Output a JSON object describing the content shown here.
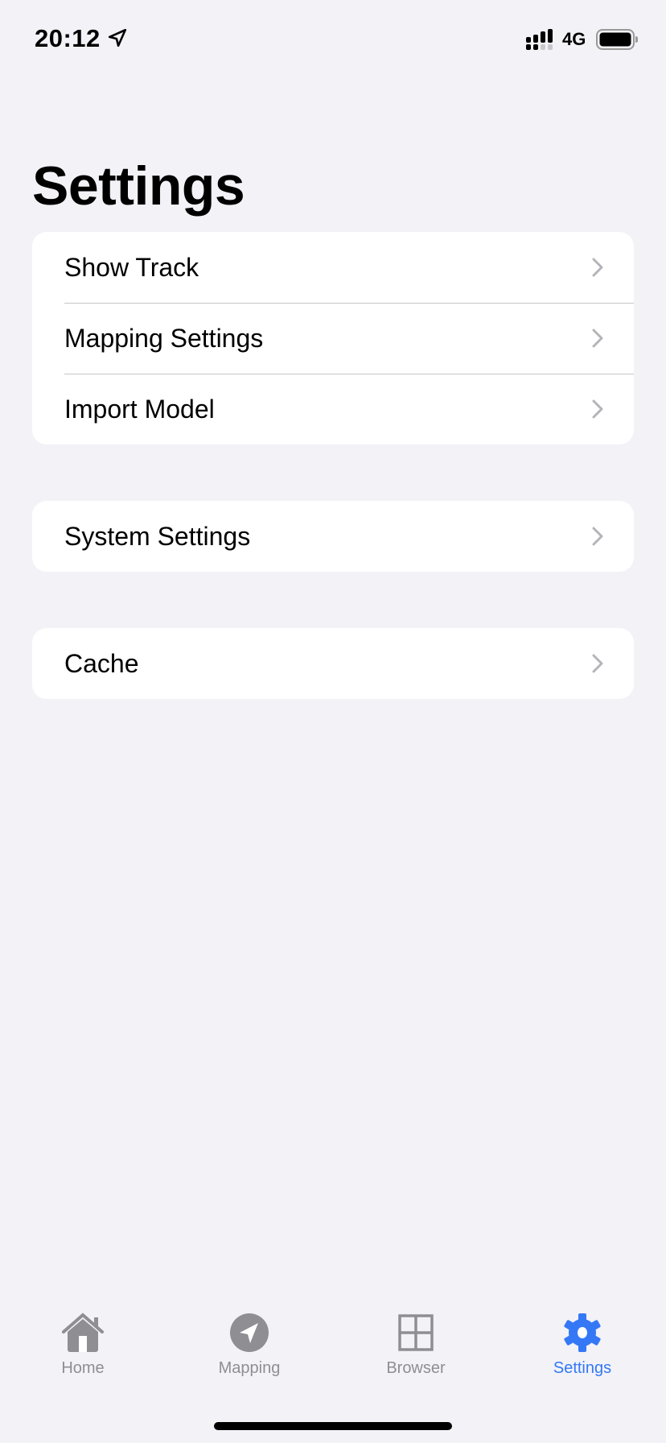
{
  "status": {
    "time": "20:12",
    "network": "4G"
  },
  "title": "Settings",
  "groups": [
    {
      "items": [
        {
          "label": "Show Track"
        },
        {
          "label": "Mapping Settings"
        },
        {
          "label": "Import Model"
        }
      ]
    },
    {
      "items": [
        {
          "label": "System Settings"
        }
      ]
    },
    {
      "items": [
        {
          "label": "Cache"
        }
      ]
    }
  ],
  "tabs": [
    {
      "label": "Home",
      "icon": "house-icon"
    },
    {
      "label": "Mapping",
      "icon": "location-arrow-icon"
    },
    {
      "label": "Browser",
      "icon": "grid-icon"
    },
    {
      "label": "Settings",
      "icon": "gear-icon"
    }
  ],
  "colors": {
    "accent": "#3478f6",
    "inactive": "#8e8e93",
    "background": "#f2f2f7"
  }
}
